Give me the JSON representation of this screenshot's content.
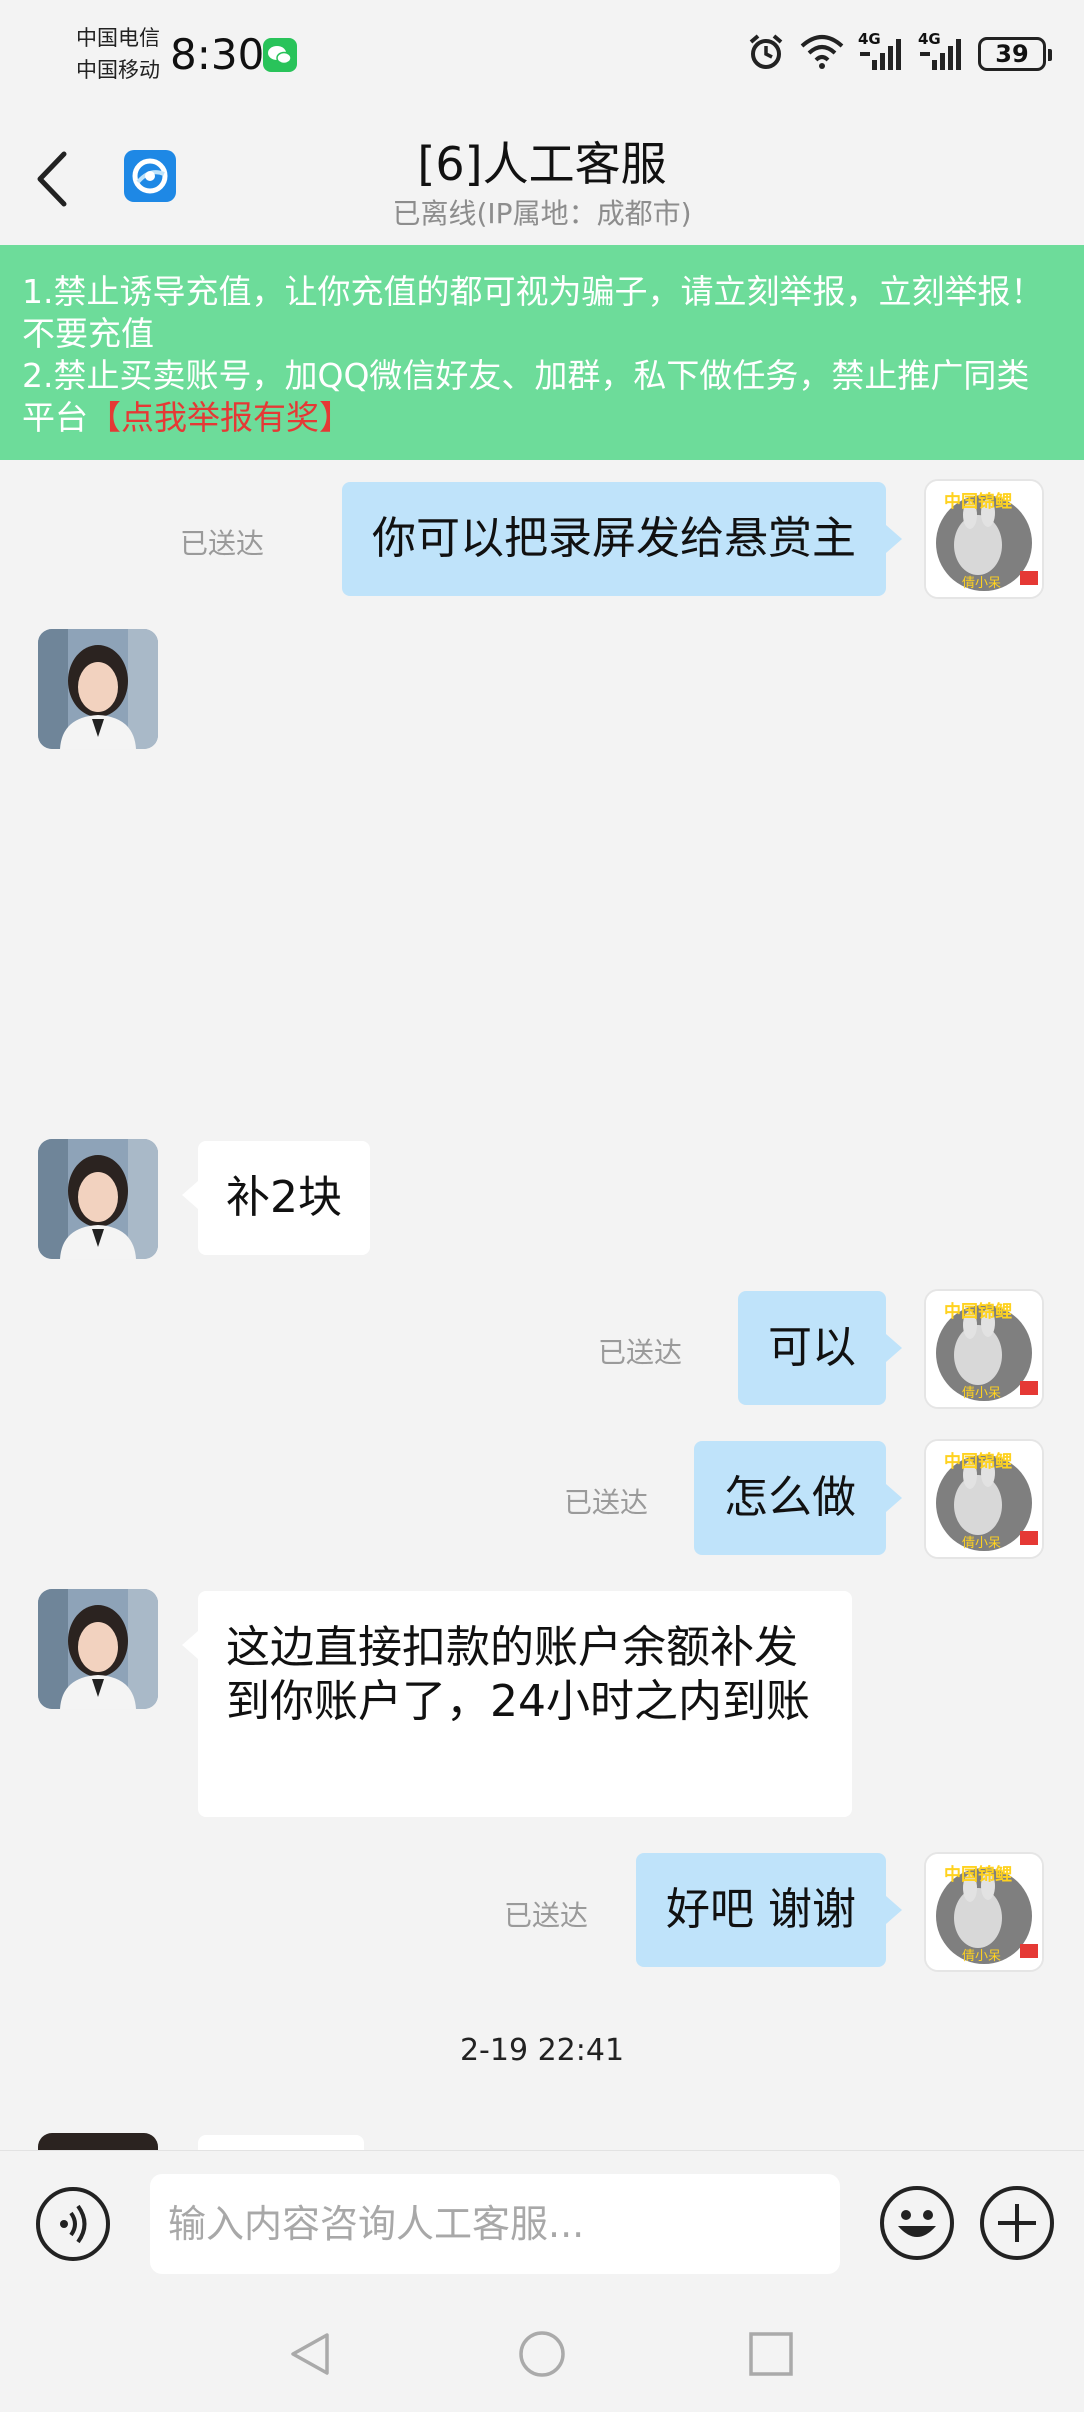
{
  "status_bar": {
    "carrier_1": "中国电信",
    "carrier_2": "中国移动",
    "time": "8:30",
    "network_1": "4G",
    "network_2": "4G",
    "battery": "39"
  },
  "header": {
    "title": "[6]人工客服",
    "subtitle": "已离线(IP属地：成都市)"
  },
  "banner": {
    "line_1": "1.禁止诱导充值，让你充值的都可视为骗子，请立刻举报，立刻举报！不要充值",
    "line_2": "2.禁止买卖账号，加QQ微信好友、加群，私下做任务，禁止推广同类平台",
    "report_link": "【点我举报有奖】"
  },
  "avatar_self_text": {
    "top": "中国锦鲤",
    "bottom": "倩小呆"
  },
  "messages": [
    {
      "from": "me",
      "text": "你可以把录屏发给悬赏主",
      "status": "已送达"
    },
    {
      "from": "agent",
      "text": ""
    },
    {
      "from": "agent",
      "text": "补2块"
    },
    {
      "from": "me",
      "text": "可以",
      "status": "已送达"
    },
    {
      "from": "me",
      "text": "怎么做",
      "status": "已送达"
    },
    {
      "from": "agent",
      "text": "这边直接扣款的账户余额补发到你账户了，24小时之内到账"
    },
    {
      "from": "me",
      "text": "好吧 谢谢",
      "status": "已送达"
    }
  ],
  "timestamp": "2-19 22:41",
  "input": {
    "placeholder": "输入内容咨询人工客服..."
  },
  "icons": {
    "back": "back-arrow-icon",
    "app_logo": "app-logo-icon",
    "voice": "voice-icon",
    "emoji": "emoji-icon",
    "add": "plus-icon"
  },
  "colors": {
    "banner_bg": "#6ddc9a",
    "report_link": "#e53935",
    "outgoing_bubble": "#bfe3fa",
    "incoming_bubble": "#ffffff",
    "page_bg": "#f3f3f3"
  }
}
